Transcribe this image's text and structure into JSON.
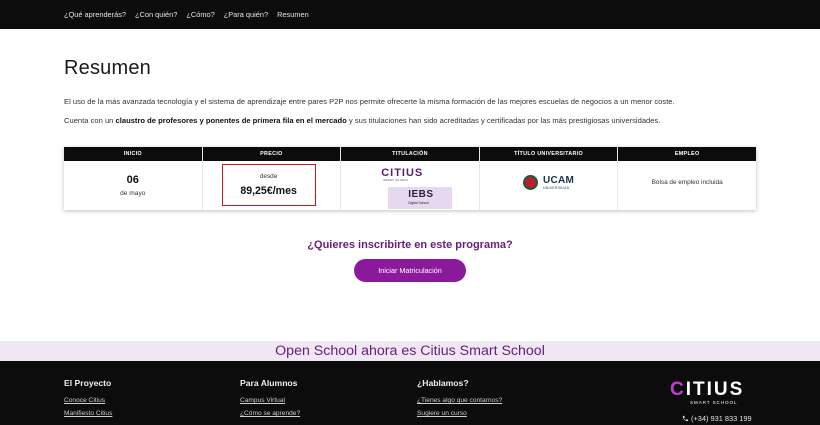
{
  "nav": {
    "items": [
      "¿Qué aprenderás?",
      "¿Con quién?",
      "¿Cómo?",
      "¿Para quién?",
      "Resumen"
    ]
  },
  "summary": {
    "title": "Resumen",
    "paragraph1": "El uso de la más avanzada tecnología y el sistema de aprendizaje entre pares P2P nos permite ofrecerte la misma formación de las mejores escuelas de negocios a un menor coste.",
    "paragraph2_pre": "Cuenta con un ",
    "paragraph2_bold": "claustro de profesores y ponentes de primera fila en el mercado",
    "paragraph2_post": " y sus titulaciones han sido acreditadas y certificadas por las más prestigiosas universidades."
  },
  "table": {
    "headers": [
      "INICIO",
      "PRECIO",
      "TITULACIÓN",
      "TÍTULO UNIVERSITARIO",
      "EMPLEO"
    ],
    "inicio_day": "06",
    "inicio_month": "de mayo",
    "precio_prefix": "desde",
    "precio_value": "89,25€/mes",
    "titulacion_logo1": "CITIUS",
    "titulacion_logo1_sub": "SMART SCHOOL",
    "titulacion_logo2": "IEBS",
    "titulacion_logo2_sub": "Digital School",
    "universidad_logo": "UCAM",
    "universidad_logo_sub": "UNIVERSIDAD",
    "empleo_text": "Bolsa de empleo incluida"
  },
  "cta": {
    "question": "¿Quieres inscribirte en este programa?",
    "button_label": "Iniciar Matriculación"
  },
  "banner": {
    "text": "Open School ahora es Citius Smart School"
  },
  "footer": {
    "col1": {
      "title": "El Proyecto",
      "links": [
        "Conoce Citius",
        "Manifiesto Citius"
      ]
    },
    "col2": {
      "title": "Para Alumnos",
      "links": [
        "Campus Virtual",
        "¿Cómo se aprende?"
      ]
    },
    "col3": {
      "title": "¿Hablamos?",
      "links": [
        "¿Tienes algo que contarnos?",
        "Sugiere un curso"
      ]
    },
    "logo_initial": "C",
    "logo_rest": "ITIUS",
    "logo_sub": "SMART SCHOOL",
    "phone": "(+34) 931 833 199",
    "phone_icon": "phone-icon"
  },
  "colors": {
    "accent_purple": "#8a1a9b",
    "heading_purple": "#6a1b7e",
    "highlight_red": "#d8131b",
    "dark_bg": "#0c0c0c"
  }
}
